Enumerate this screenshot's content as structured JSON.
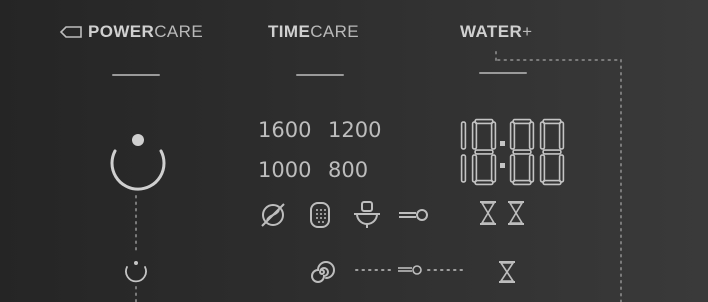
{
  "options": {
    "powercare": {
      "bold": "POWER",
      "light": "CARE"
    },
    "timecare": {
      "bold": "TIME",
      "light": "CARE"
    },
    "water": {
      "bold": "WATER",
      "light": "+"
    }
  },
  "spin_speeds": [
    "1600",
    "1200",
    "1000",
    "800"
  ],
  "display": {
    "digits": [
      "1",
      "8",
      "8",
      "8"
    ],
    "separator": ":"
  },
  "icons": {
    "power": "power-icon",
    "power_small": "small-power-icon",
    "no_spin": "no-spin-icon",
    "drum": "drum-icon",
    "prewash": "prewash-basin-icon",
    "child_lock": "child-lock-key-icon",
    "delay_end": "hourglass-icon",
    "rinse_hold": "spiral-icon"
  },
  "colors": {
    "segment": "#c4c4c4",
    "label": "#b9b9b9",
    "dots": "#7c7c7c"
  }
}
